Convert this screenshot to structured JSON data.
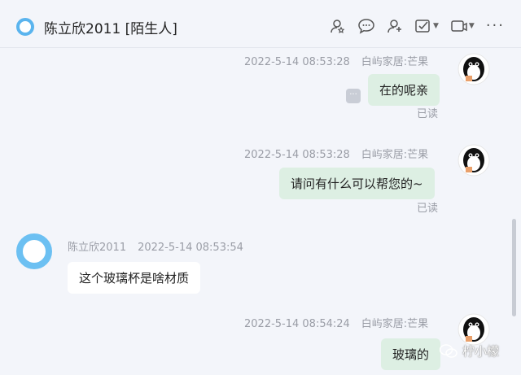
{
  "header": {
    "title": "陈立欣2011 [陌生人]",
    "tools": [
      "add-contact-icon",
      "chat-bubble-icon",
      "add-friend-icon",
      "task-check-icon",
      "video-call-icon",
      "more-icon"
    ],
    "more_label": "···"
  },
  "messages": [
    {
      "side": "me",
      "time": "2022-5-14 08:53:28",
      "nick": "白屿家居:芒果",
      "text": "在的呢亲",
      "read": "已读"
    },
    {
      "side": "me",
      "time": "2022-5-14 08:53:28",
      "nick": "白屿家居:芒果",
      "text": "请问有什么可以帮您的~",
      "read": "已读"
    },
    {
      "side": "them",
      "nick": "陈立欣2011",
      "time": "2022-5-14 08:53:54",
      "text": "这个玻璃杯是啥材质"
    },
    {
      "side": "me",
      "time": "2022-5-14 08:54:24",
      "nick": "白屿家居:芒果",
      "text": "玻璃的"
    }
  ],
  "more_chip": "···",
  "watermark": {
    "text": "柠小檬"
  },
  "colors": {
    "my_bubble": "#ddefe3",
    "their_bubble": "#ffffff",
    "avatar_blue": "#5ab4ee",
    "background": "#f3f5fa"
  }
}
